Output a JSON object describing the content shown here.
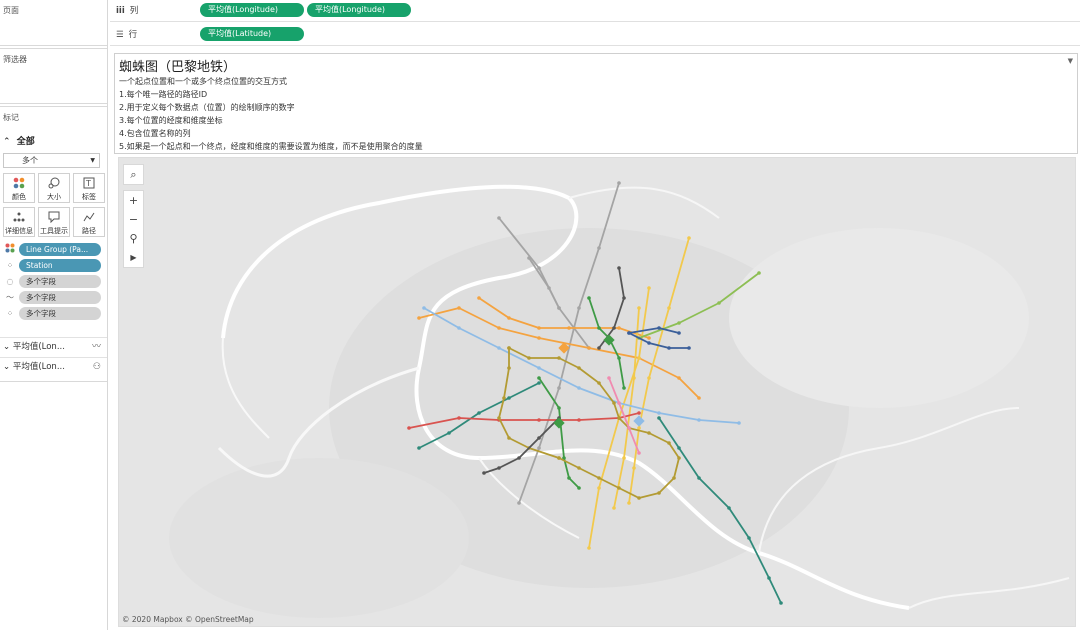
{
  "left_panel": {
    "pages_title": "页面",
    "filters_title": "筛选器",
    "marks_title": "标记",
    "marks_all": "全部",
    "mark_type": "多个",
    "buttons": [
      {
        "id": "color",
        "label": "颜色",
        "icon": "color-icon"
      },
      {
        "id": "size",
        "label": "大小",
        "icon": "size-icon"
      },
      {
        "id": "label",
        "label": "标签",
        "icon": "label-icon"
      },
      {
        "id": "detail",
        "label": "详细信息",
        "icon": "detail-icon"
      },
      {
        "id": "tooltip",
        "label": "工具提示",
        "icon": "tooltip-icon"
      },
      {
        "id": "path",
        "label": "路径",
        "icon": "path-icon"
      }
    ],
    "pills": [
      {
        "text": "Line Group (Pa...",
        "style": "blue",
        "icon": "color-dots-icon"
      },
      {
        "text": "Station",
        "style": "blue",
        "icon": "detail-icon"
      },
      {
        "text": "多个字段",
        "style": "grey",
        "icon": "size-icon"
      },
      {
        "text": "多个字段",
        "style": "grey",
        "icon": "path-icon"
      },
      {
        "text": "多个字段",
        "style": "grey",
        "icon": "detail-icon"
      }
    ],
    "sub_layers": [
      {
        "text": "平均值(Lon...",
        "icon": "line-icon"
      },
      {
        "text": "平均值(Lon...",
        "icon": "shapes-icon"
      }
    ]
  },
  "shelves": {
    "columns_label": "列",
    "rows_label": "行",
    "columns_pills": [
      "平均值(Longitude)",
      "平均值(Longitude)"
    ],
    "rows_pills": [
      "平均值(Latitude)"
    ]
  },
  "title_panel": {
    "title": "蜘蛛图（巴黎地铁）",
    "lines": [
      "一个起点位置和一个或多个终点位置的交互方式",
      "1.每个唯一路径的路径ID",
      "2.用于定义每个数据点（位置）的绘制顺序的数字",
      "3.每个位置的经度和维度坐标",
      "4.包含位置名称的列",
      "5.如果是一个起点和一个终点，经度和维度的需要设置为维度，而不是使用聚合的度量"
    ]
  },
  "map": {
    "attribution": "© 2020 Mapbox © OpenStreetMap",
    "tools": [
      "search-icon",
      "zoom-in-icon",
      "zoom-out-icon",
      "pin-icon",
      "play-icon"
    ],
    "line_colors": {
      "grey": "#a4a4a4",
      "orange": "#f4a340",
      "yellow": "#f2c94c",
      "green": "#3f9b46",
      "lightgreen": "#8dbf54",
      "blue": "#8fbce6",
      "navy": "#3b5f9a",
      "teal": "#2f8a7a",
      "red": "#d9534f",
      "olive": "#b39b33",
      "darkgrey": "#555555",
      "pink": "#f08bb0"
    }
  }
}
